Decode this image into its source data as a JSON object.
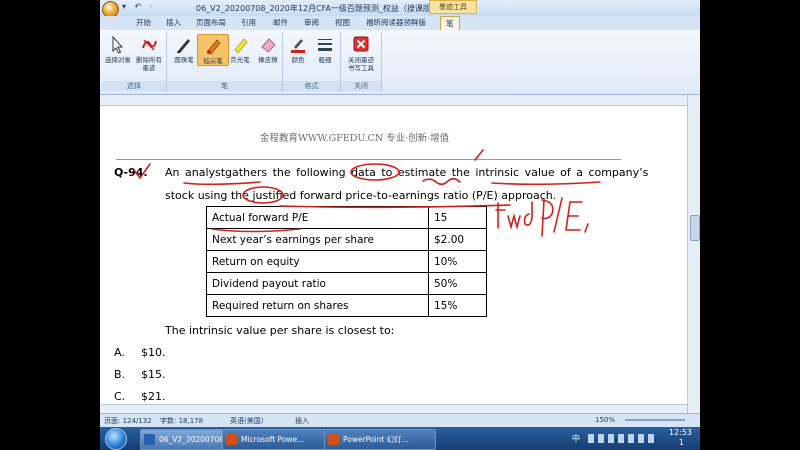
{
  "window": {
    "title": "06_V2_20200708_2020年12月CFA一级百题预测_权益（搜课版） - Mic...",
    "context_tab": "墨迹工具",
    "quick_access": "▾ ↶ ·"
  },
  "ribbon": {
    "tabs": [
      "开始",
      "插入",
      "页面布局",
      "引用",
      "邮件",
      "审阅",
      "视图",
      "福昕阅读器领鲜版",
      "笔"
    ],
    "active_tab": "笔",
    "groups": [
      {
        "label": "选择",
        "buttons": [
          "选择对象",
          "删除所有墨迹"
        ]
      },
      {
        "label": "笔",
        "buttons": [
          "圆珠笔",
          "毡尖笔",
          "荧光笔",
          "橡皮擦"
        ]
      },
      {
        "label": "格式",
        "buttons": [
          "颜色",
          "粗细"
        ]
      },
      {
        "label": "关闭",
        "buttons": [
          "关闭墨迹书写工具"
        ]
      }
    ]
  },
  "document": {
    "header": "金程教育WWW.GFEDU.CN 专业·创新·增值",
    "question_number": "Q-94.",
    "question_line1": "An analystgathers the following data to estimate the intrinsic value of a company’s",
    "question_line2": "stock using the justified forward price-to-earnings ratio (P/E) approach.",
    "table": [
      {
        "label": "Actual forward P/E",
        "value": "15"
      },
      {
        "label": "Next year’s earnings per share",
        "value": "$2.00"
      },
      {
        "label": "Return on equity",
        "value": "10%"
      },
      {
        "label": "Dividend payout ratio",
        "value": "50%"
      },
      {
        "label": "Required return on shares",
        "value": "15%"
      }
    ],
    "prompt": "The intrinsic value per share is closest to:",
    "options": [
      {
        "letter": "A.",
        "text": "$10."
      },
      {
        "letter": "B.",
        "text": "$15."
      },
      {
        "letter": "C.",
        "text": "$21."
      }
    ],
    "handwriting": "fwd P/E,"
  },
  "status_bar": {
    "page": "页面: 124/132",
    "words": "字数: 18,178",
    "language": "英语(美国)",
    "mode": "插入",
    "zoom": "150%"
  },
  "taskbar": {
    "items": [
      "06_V2_20200708...",
      "Microsoft Powe...",
      "PowerPoint 幻灯..."
    ],
    "time": "12:53",
    "date": "1",
    "ime": "中"
  },
  "colors": {
    "ink": "#d0211c",
    "ribbon_bg": "#dfe9f6",
    "taskbar": "#1f4f8c"
  }
}
